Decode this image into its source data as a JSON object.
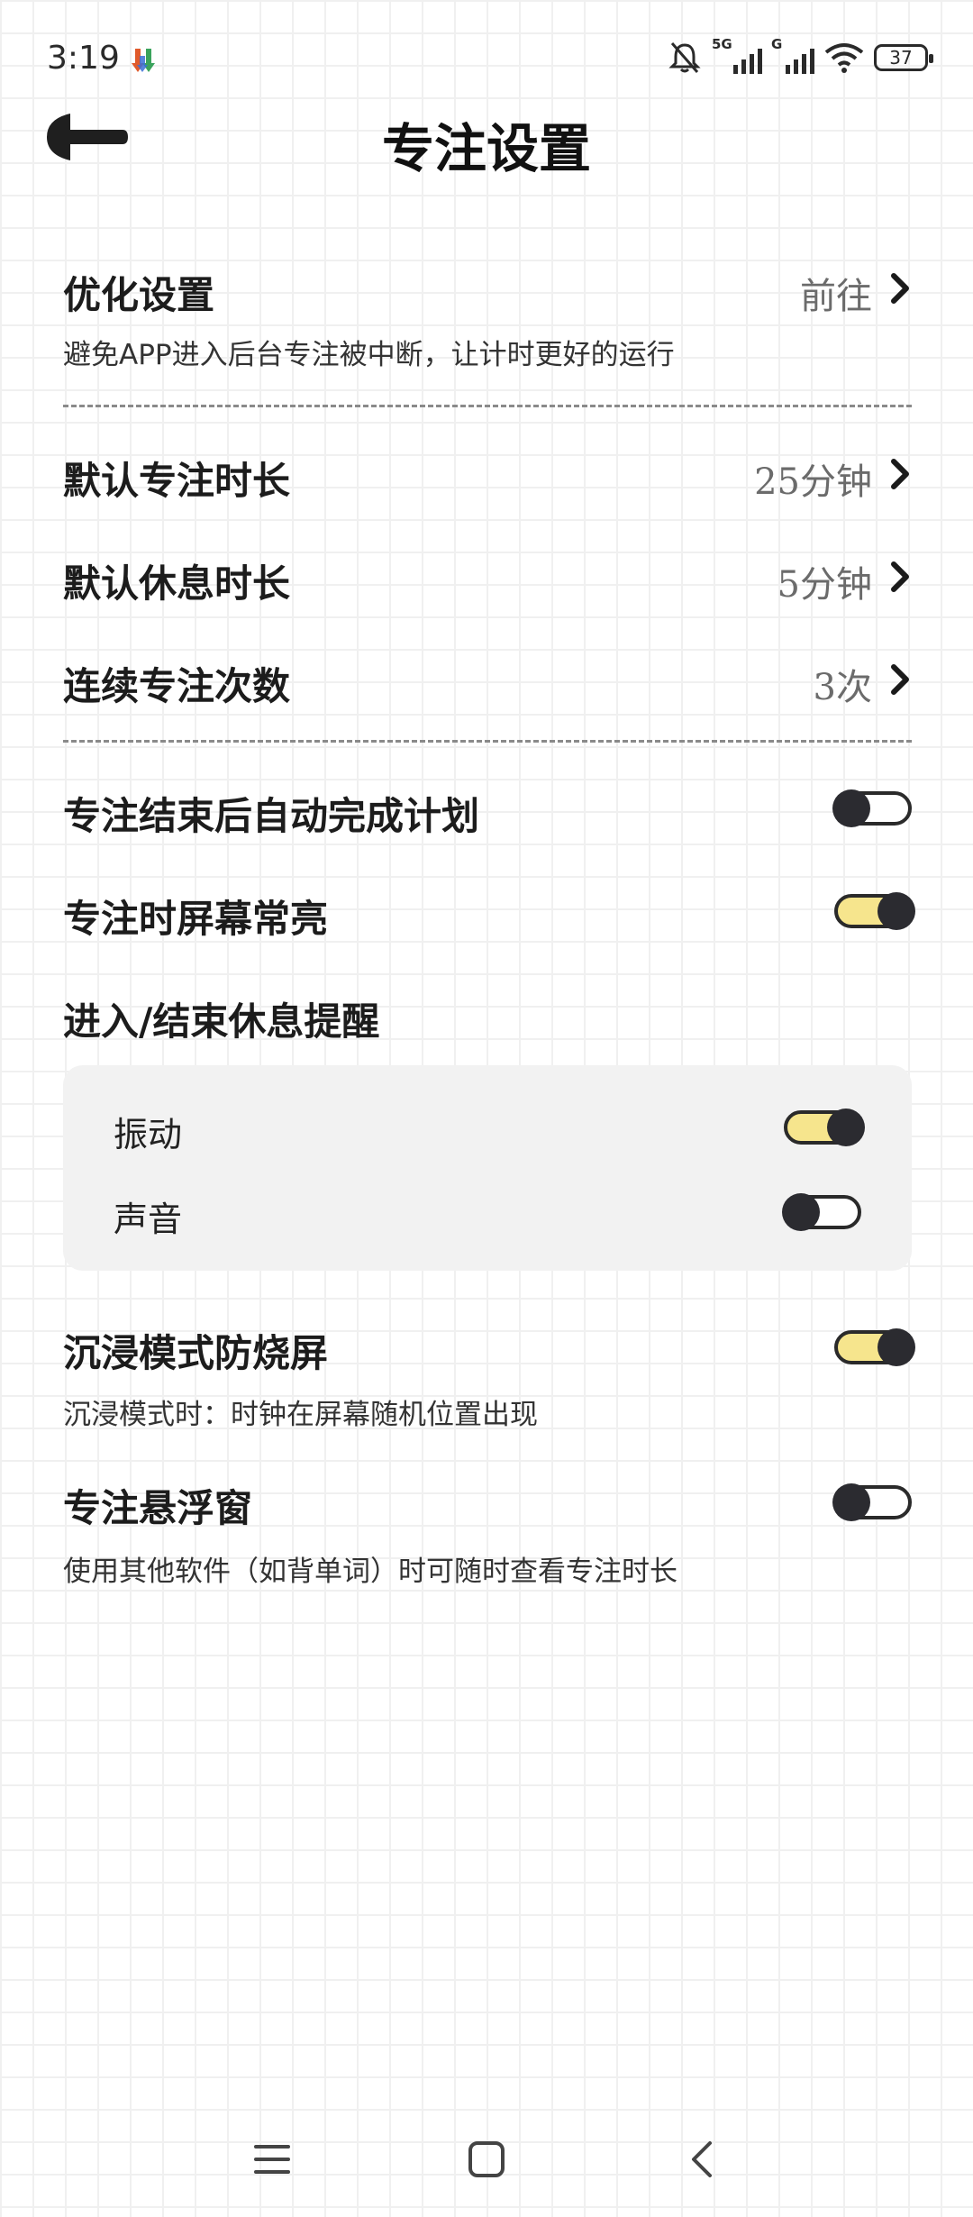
{
  "status_bar": {
    "time": "3:19",
    "app_icon": "download-arrows-icon",
    "sim1_tag": "5G",
    "sim2_tag": "G",
    "battery": "37"
  },
  "header": {
    "back_icon": "arrow-left-icon",
    "title": "专注设置"
  },
  "optimize": {
    "title": "优化设置",
    "value": "前往",
    "subtitle": "避免APP进入后台专注被中断，让计时更好的运行"
  },
  "durations": [
    {
      "title": "默认专注时长",
      "value": "25分钟"
    },
    {
      "title": "默认休息时长",
      "value": "5分钟"
    },
    {
      "title": "连续专注次数",
      "value": "3次"
    }
  ],
  "toggles": {
    "auto_complete": {
      "title": "专注结束后自动完成计划",
      "on": false
    },
    "screen_on": {
      "title": "专注时屏幕常亮",
      "on": true
    }
  },
  "reminder": {
    "title": "进入/结束休息提醒",
    "vibration": {
      "label": "振动",
      "on": true
    },
    "sound": {
      "label": "声音",
      "on": false
    }
  },
  "immersive": {
    "title": "沉浸模式防烧屏",
    "subtitle": "沉浸模式时：时钟在屏幕随机位置出现",
    "on": true
  },
  "floating": {
    "title": "专注悬浮窗",
    "subtitle": "使用其他软件（如背单词）时可随时查看专注时长",
    "on": false
  },
  "colors": {
    "toggle_on": "#f6e58d",
    "knob": "#2b2b30"
  },
  "nav_bar": {
    "menu_icon": "menu-icon",
    "home_icon": "home-square-icon",
    "back_icon": "back-chevron-icon"
  }
}
